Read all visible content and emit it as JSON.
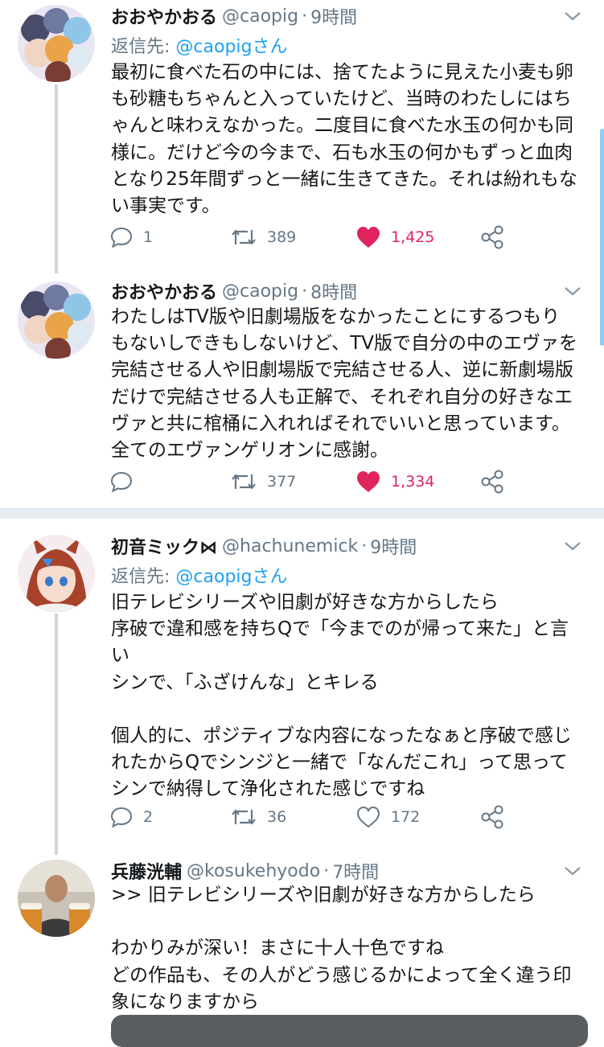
{
  "tweets": [
    {
      "name": "おおやかおる",
      "handle": "@caopig",
      "time": "9時間",
      "reply_label": "返信先: ",
      "reply_to": "@caopigさん",
      "text": "最初に食べた石の中には、捨てたように見えた小麦も卵\nも砂糖もちゃんと入っていたけど、当時のわたしにはち\nゃんと味わえなかった。二度目に食べた水玉の何かも同\n様に。だけど今の今まで、石も水玉の何かもずっと血肉\nとなり25年間ずっと一緒に生きてきた。それは紛れもな\nい事実です。",
      "replies": "1",
      "retweets": "389",
      "likes": "1,425",
      "liked": true
    },
    {
      "name": "おおやかおる",
      "handle": "@caopig",
      "time": "8時間",
      "text": "わたしはTV版や旧劇場版をなかったことにするつもり\nもないしできもしないけど、TV版で自分の中のエヴァを\n完結させる人や旧劇場版で完結させる人、逆に新劇場版\nだけで完結させる人も正解で、それぞれ自分の好きなエ\nヴァと共に棺桶に入れればそれでいいと思っています。\n全てのエヴァンゲリオンに感謝。",
      "replies": "",
      "retweets": "377",
      "likes": "1,334",
      "liked": true
    },
    {
      "name": "初音ミック⋈",
      "handle": "@hachunemick",
      "time": "9時間",
      "reply_label": "返信先: ",
      "reply_to": "@caopigさん",
      "text": "旧テレビシリーズや旧劇が好きな方からしたら\n序破で違和感を持ちQで「今までのが帰って来た」と言\nい\nシンで、「ふざけんな」とキレる\n\n個人的に、ポジティブな内容になったなぁと序破で感じ\nれたからQでシンジと一緒で「なんだこれ」って思って\nシンで納得して浄化された感じですね",
      "replies": "2",
      "retweets": "36",
      "likes": "172",
      "liked": false
    },
    {
      "name": "兵藤洸輔",
      "handle": "@kosukehyodo",
      "time": "7時間",
      "text": ">> 旧テレビシリーズや旧劇が好きな方からしたら\n\nわかりみが深い！まさに十人十色ですね\nどの作品も、その人がどう感じるかによって全く違う印\n象になりますから"
    }
  ],
  "colors": {
    "link": "#1da1f2",
    "like": "#e0245e",
    "muted": "#657786"
  },
  "icons": [
    "reply-icon",
    "retweet-icon",
    "like-icon",
    "share-icon",
    "chevron-down-icon"
  ]
}
